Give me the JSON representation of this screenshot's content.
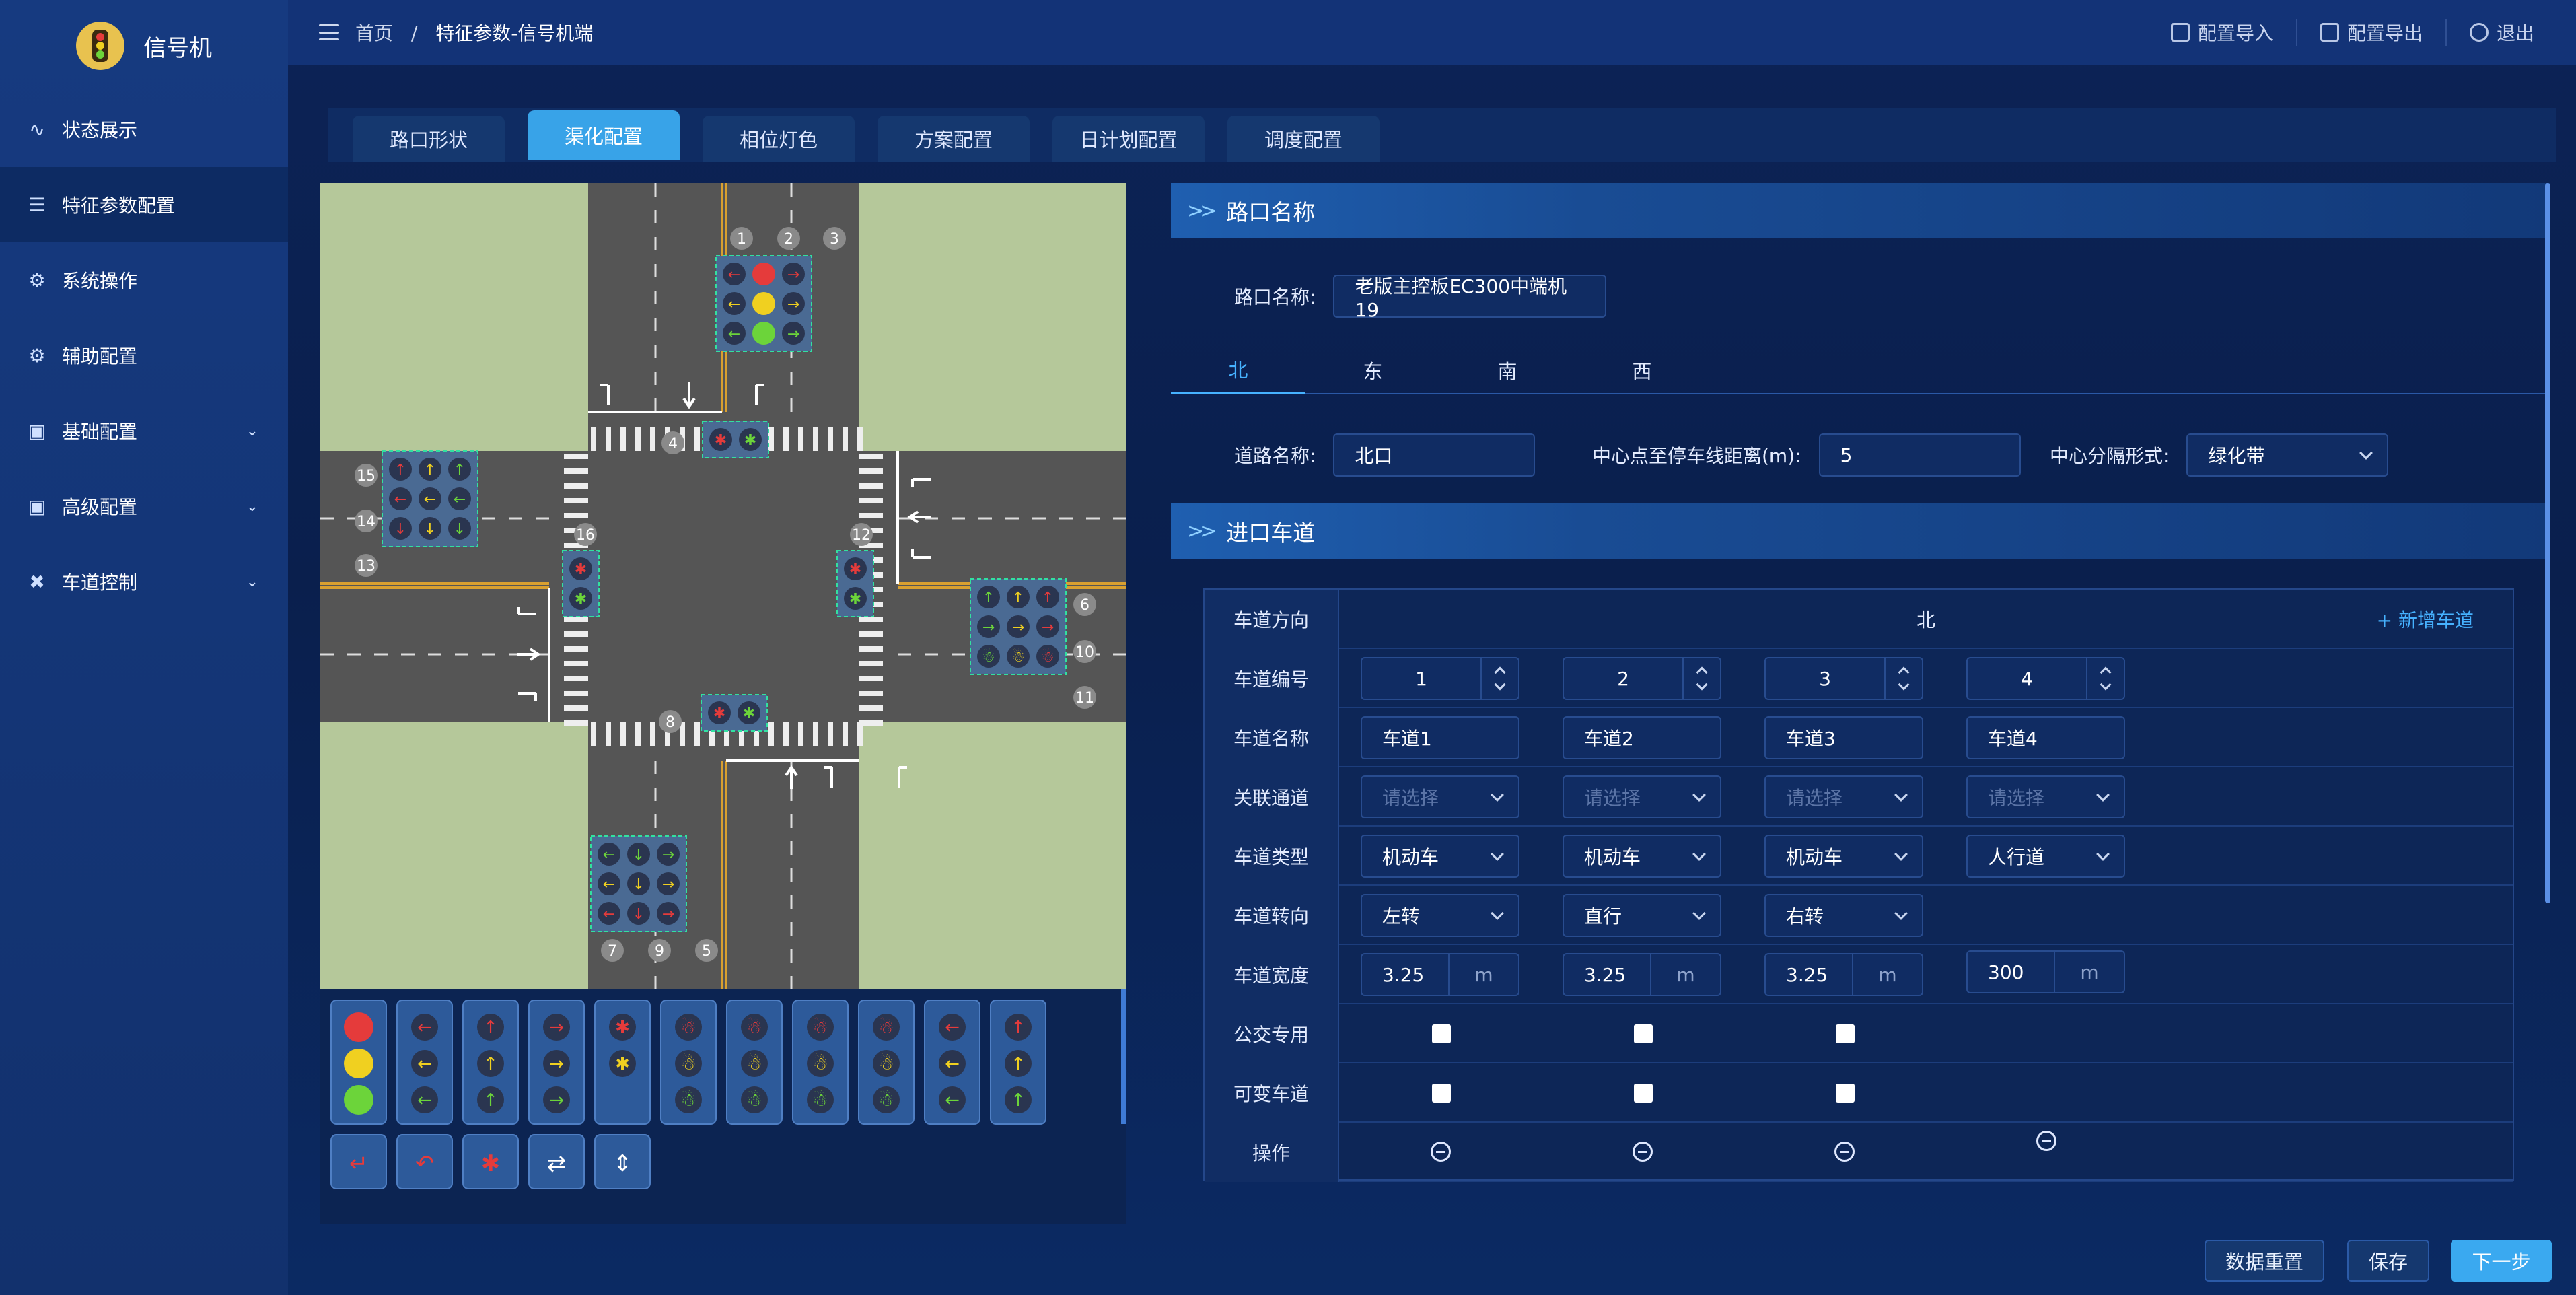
{
  "app": {
    "title": "信号机"
  },
  "sidebar": {
    "items": [
      {
        "label": "状态展示",
        "icon": "activity-icon",
        "active": false,
        "caret": false
      },
      {
        "label": "特征参数配置",
        "icon": "settings-list-icon",
        "active": true,
        "caret": false
      },
      {
        "label": "系统操作",
        "icon": "gear-icon",
        "active": false,
        "caret": false
      },
      {
        "label": "辅助配置",
        "icon": "cog-small-icon",
        "active": false,
        "caret": false
      },
      {
        "label": "基础配置",
        "icon": "config-icon",
        "active": false,
        "caret": true
      },
      {
        "label": "高级配置",
        "icon": "config-icon",
        "active": false,
        "caret": true
      },
      {
        "label": "车道控制",
        "icon": "tools-icon",
        "active": false,
        "caret": true
      }
    ]
  },
  "header": {
    "breadcrumb": {
      "home": "首页",
      "sep": "/",
      "current": "特征参数-信号机端"
    },
    "actions": [
      {
        "label": "配置导入"
      },
      {
        "label": "配置导出"
      },
      {
        "label": "退出"
      }
    ]
  },
  "tabs": [
    {
      "label": "路口形状",
      "active": false
    },
    {
      "label": "渠化配置",
      "active": true
    },
    {
      "label": "相位灯色",
      "active": false
    },
    {
      "label": "方案配置",
      "active": false
    },
    {
      "label": "日计划配置",
      "active": false
    },
    {
      "label": "调度配置",
      "active": false
    }
  ],
  "intersection": {
    "signal_numbers": [
      "1",
      "2",
      "3",
      "4",
      "5",
      "6",
      "7",
      "8",
      "9",
      "10",
      "11",
      "12",
      "13",
      "14",
      "15",
      "16"
    ]
  },
  "section_name": {
    "title": "路口名称",
    "label": "路口名称:",
    "value": "老版主控板EC300中端机19"
  },
  "directions": [
    {
      "label": "北",
      "active": true
    },
    {
      "label": "东",
      "active": false
    },
    {
      "label": "南",
      "active": false
    },
    {
      "label": "西",
      "active": false
    }
  ],
  "road": {
    "name_label": "道路名称:",
    "name_value": "北口",
    "distance_label": "中心点至停车线距离(m):",
    "distance_value": "5",
    "divider_label": "中心分隔形式:",
    "divider_value": "绿化带"
  },
  "section_lanes": {
    "title": "进口车道"
  },
  "lane_table": {
    "direction_label": "车道方向",
    "direction_value": "北",
    "add_label": "+ 新增车道",
    "row_labels": [
      "车道编号",
      "车道名称",
      "关联通道",
      "车道类型",
      "车道转向",
      "车道宽度",
      "公交专用",
      "可变车道",
      "操作"
    ],
    "unit": "m",
    "lanes": [
      {
        "number": "1",
        "name": "车道1",
        "channel": "请选择",
        "type": "机动车",
        "turn": "左转",
        "width": "3.25",
        "bus": true,
        "variable": true
      },
      {
        "number": "2",
        "name": "车道2",
        "channel": "请选择",
        "type": "机动车",
        "turn": "直行",
        "width": "3.25",
        "bus": true,
        "variable": true
      },
      {
        "number": "3",
        "name": "车道3",
        "channel": "请选择",
        "type": "机动车",
        "turn": "右转",
        "width": "3.25",
        "bus": true,
        "variable": true
      },
      {
        "number": "4",
        "name": "车道4",
        "channel": "请选择",
        "type": "人行道",
        "turn": "",
        "width": "300",
        "bus": false,
        "variable": false
      }
    ]
  },
  "buttons": {
    "reset": "数据重置",
    "save": "保存",
    "next": "下一步"
  },
  "colors": {
    "accent": "#38a3e8",
    "sidebar": "#163a80",
    "background": "#0a1d4a",
    "grass": "#b5c89a",
    "road": "#555555",
    "signal_red": "#e53b3b",
    "signal_yellow": "#f0d020",
    "signal_green": "#6cd43a"
  }
}
